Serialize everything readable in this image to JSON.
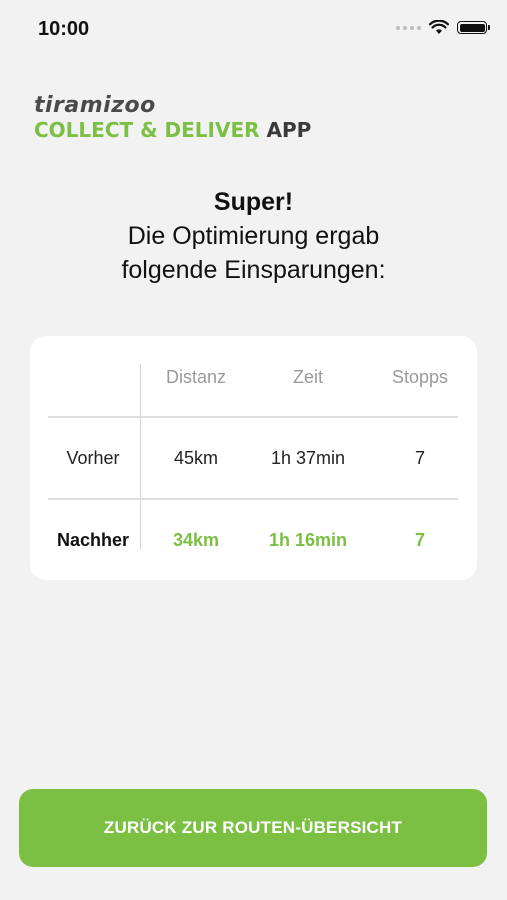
{
  "status_bar": {
    "time": "10:00"
  },
  "brand": {
    "name": "tiramizoo",
    "sub_green": "COLLECT & DELIVER",
    "sub_dark": "APP"
  },
  "headline": {
    "title": "Super!",
    "line1": "Die Optimierung ergab",
    "line2": "folgende Einsparungen:"
  },
  "table": {
    "columns": [
      "Distanz",
      "Zeit",
      "Stopps"
    ],
    "rows": [
      {
        "label": "Vorher",
        "values": [
          "45km",
          "1h 37min",
          "7"
        ]
      },
      {
        "label": "Nachher",
        "values": [
          "34km",
          "1h 16min",
          "7"
        ]
      }
    ]
  },
  "cta": {
    "label": "ZURÜCK ZUR ROUTEN-ÜBERSICHT"
  },
  "colors": {
    "accent": "#7bc043",
    "background": "#f2f2f2"
  }
}
